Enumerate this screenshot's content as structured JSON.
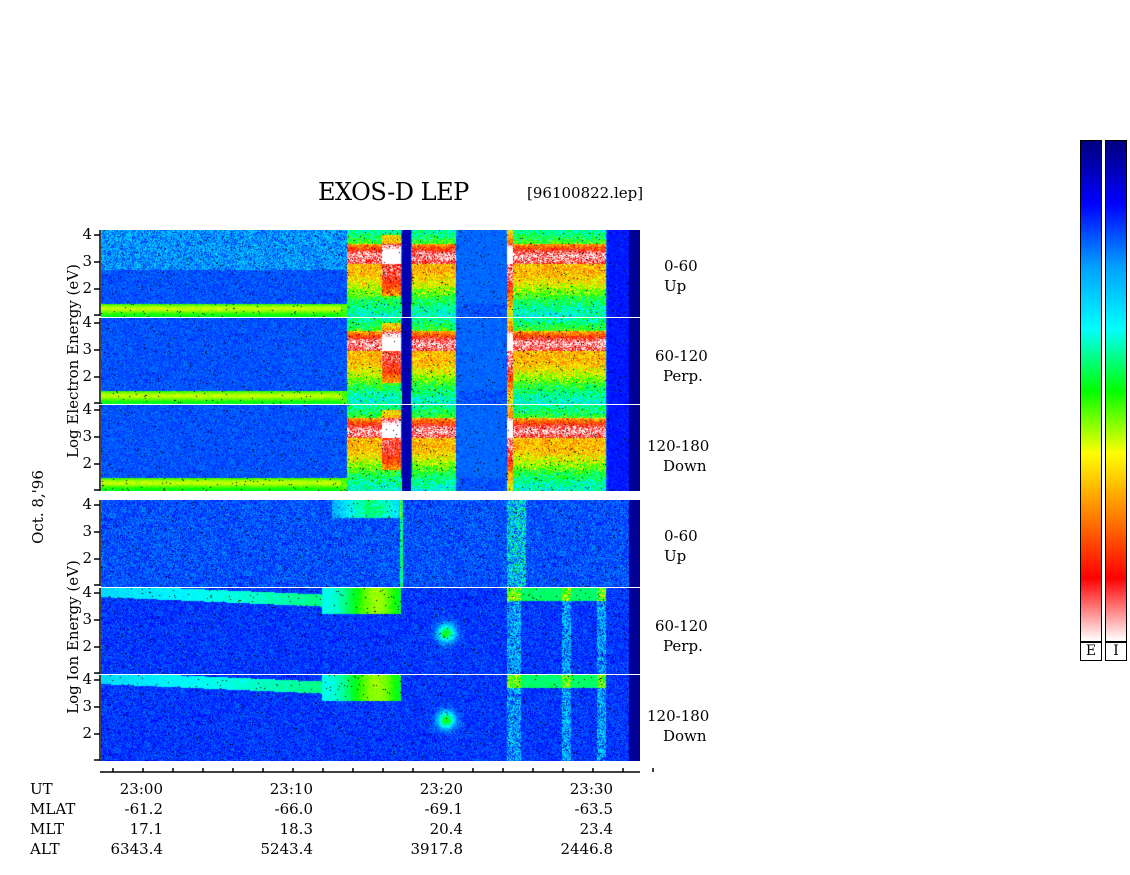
{
  "header": {
    "title": "EXOS-D LEP",
    "file": "[96100822.lep]"
  },
  "side_labels": {
    "date": "Oct. 8,'96",
    "electron_axis": "Log  Electron  Energy (eV)",
    "ion_axis": "Log  Ion  Energy (eV)"
  },
  "panels": [
    {
      "angle": "0-60",
      "dir": "Up"
    },
    {
      "angle": "60-120",
      "dir": "Perp."
    },
    {
      "angle": "120-180",
      "dir": "Down"
    },
    {
      "angle": "0-60",
      "dir": "Up"
    },
    {
      "angle": "60-120",
      "dir": "Perp."
    },
    {
      "angle": "120-180",
      "dir": "Down"
    }
  ],
  "y_ticks": [
    "4",
    "3",
    "2"
  ],
  "orbit": {
    "names": [
      "UT",
      "MLAT",
      "MLT",
      "ALT"
    ],
    "columns": [
      {
        "UT": "23:00",
        "MLAT": "-61.2",
        "MLT": "17.1",
        "ALT": "6343.4"
      },
      {
        "UT": "23:10",
        "MLAT": "-66.0",
        "MLT": "18.3",
        "ALT": "5243.4"
      },
      {
        "UT": "23:20",
        "MLAT": "-69.1",
        "MLT": "20.4",
        "ALT": "3917.8"
      },
      {
        "UT": "23:30",
        "MLAT": "-63.5",
        "MLT": "23.4",
        "ALT": "2446.8"
      }
    ]
  },
  "colorbars": {
    "electron_tag": "E",
    "ion_tag": "I"
  },
  "chart_data": {
    "type": "heatmap",
    "title": "EXOS-D LEP",
    "xlabel": "UT",
    "ylabel": "Log Energy (eV)",
    "x_ticks": [
      "23:00",
      "23:10",
      "23:20",
      "23:30"
    ],
    "ylim": [
      1,
      4.2
    ],
    "species": [
      {
        "name": "Electron",
        "panels": [
          "0-60 Up",
          "60-120 Perp.",
          "120-180 Down"
        ]
      },
      {
        "name": "Ion",
        "panels": [
          "0-60 Up",
          "60-120 Perp.",
          "120-180 Down"
        ]
      }
    ],
    "colorscale": [
      "#000080",
      "#0000ff",
      "#00a0ff",
      "#00ffff",
      "#00ff00",
      "#ffff00",
      "#ff8000",
      "#ff0000",
      "#ffffff"
    ]
  }
}
